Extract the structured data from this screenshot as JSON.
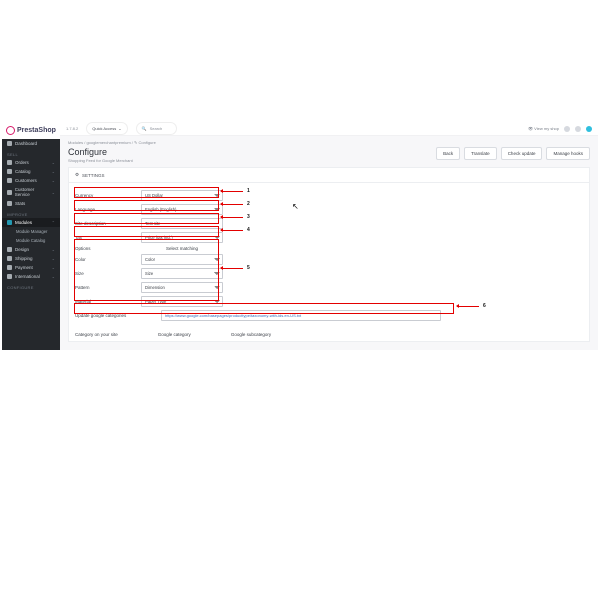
{
  "brand": "PrestaShop",
  "version": "1.7.8.2",
  "quickAccess": "Quick Access",
  "searchPlaceholder": "Search",
  "viewShop": "View my shop",
  "breadcrumb": "Modules  /  googlemerchantpremium  /  ✎ Configure",
  "title": "Configure",
  "subtitle": "Shopping Feed for Google Merchant",
  "buttons": {
    "back": "Back",
    "translate": "Translate",
    "check": "Check update",
    "hooks": "Manage hooks"
  },
  "panelTitle": "SETTINGS",
  "nav": {
    "dashboard": "Dashboard",
    "sellHeader": "SELL",
    "orders": "Orders",
    "catalog": "Catalog",
    "customers": "Customers",
    "customerService": "Customer Service",
    "stats": "Stats",
    "improveHeader": "IMPROVE",
    "modules": "Modules",
    "moduleManager": "Module Manager",
    "moduleCatalog": "Module Catalog",
    "design": "Design",
    "shipping": "Shipping",
    "payment": "Payment",
    "international": "International",
    "configureHeader": "CONFIGURE"
  },
  "form": {
    "currencyLabel": "Currency",
    "currencyValue": "US Dollar",
    "languageLabel": "Language",
    "languageValue": "English (English)",
    "siteDescLabel": "Site description",
    "siteDescValue": "Test site",
    "taxLabel": "Tax",
    "taxValue": "Price (tax incl.)",
    "optionsLabel": "Options",
    "matchingLabel": "Select matching",
    "colorLabel": "Color",
    "colorValue": "Color",
    "sizeLabel": "Size",
    "sizeValue": "Size",
    "patternLabel": "Pattern",
    "patternValue": "Dimension",
    "materialLabel": "Material",
    "materialValue": "Paper Type",
    "updateCatsLabel": "Update google categories",
    "updateCatsValue": "https://www.google.com/basepages/producttype/taxonomy-with-ids.en-US.txt"
  },
  "catHeaders": {
    "c1": "Category on your site",
    "c2": "Google category",
    "c3": "Google subcategory"
  },
  "anno": {
    "n1": "1",
    "n2": "2",
    "n3": "3",
    "n4": "4",
    "n5": "5",
    "n6": "6"
  }
}
